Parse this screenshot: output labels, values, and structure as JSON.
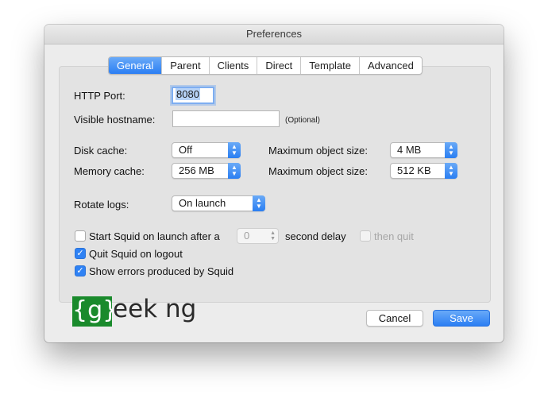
{
  "window": {
    "title": "Preferences"
  },
  "tabs": [
    {
      "label": "General",
      "active": true
    },
    {
      "label": "Parent"
    },
    {
      "label": "Clients"
    },
    {
      "label": "Direct"
    },
    {
      "label": "Template"
    },
    {
      "label": "Advanced"
    }
  ],
  "general": {
    "http_port_label": "HTTP Port:",
    "http_port_value": "8080",
    "hostname_label": "Visible hostname:",
    "hostname_value": "",
    "hostname_hint": "(Optional)",
    "disk_cache_label": "Disk cache:",
    "disk_cache_value": "Off",
    "memory_cache_label": "Memory cache:",
    "memory_cache_value": "256 MB",
    "max_object_label_1": "Maximum object size:",
    "max_object_value_1": "4 MB",
    "max_object_label_2": "Maximum object size:",
    "max_object_value_2": "512 KB",
    "rotate_logs_label": "Rotate logs:",
    "rotate_logs_value": "On launch",
    "start_squid_label": "Start Squid on launch after a",
    "start_squid_checked": false,
    "delay_value": "0",
    "delay_suffix": "second delay",
    "then_quit_label": "then quit",
    "then_quit_checked": false,
    "quit_on_logout_label": "Quit Squid on logout",
    "quit_on_logout_checked": true,
    "show_errors_label": "Show errors produced by Squid",
    "show_errors_checked": true
  },
  "buttons": {
    "cancel": "Cancel",
    "save": "Save"
  },
  "watermark": {
    "box": "{g}",
    "text": "eek ng"
  },
  "colors": {
    "accent": "#2b7ef3",
    "logo_green": "#1a8a2c"
  }
}
